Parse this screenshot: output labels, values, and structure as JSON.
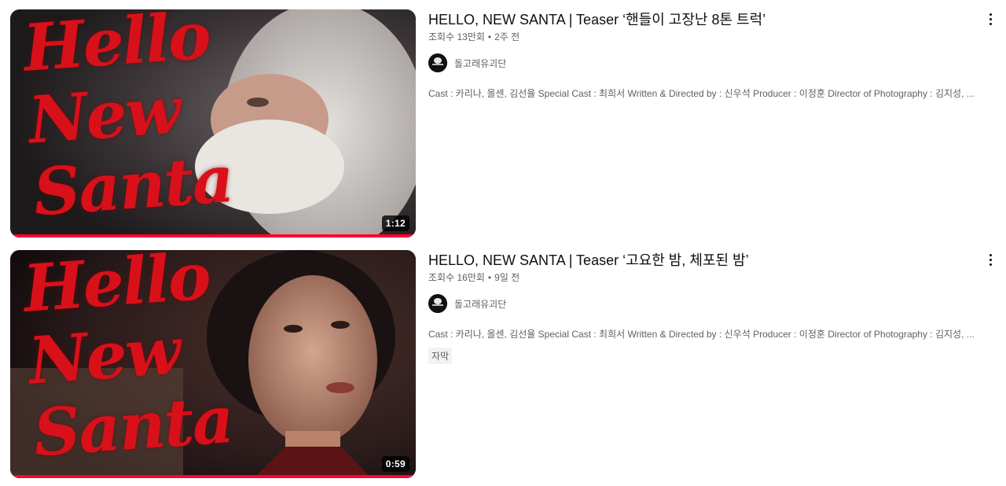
{
  "videos": [
    {
      "title": "HELLO, NEW SANTA | Teaser ‘핸들이 고장난 8톤 트럭’",
      "views": "조회수 13만회",
      "age": "2주 전",
      "channel": "돌고래유괴단",
      "description": "Cast : 카리나, 올센, 김선율 Special Cast : 최희서 Written & Directed by : 신우석 Producer : 이정훈 Director of Photography : 김지성, ...",
      "duration": "1:12",
      "thumbnail_text": "Hello\nNew\nSanta",
      "badge": "",
      "progress": 1.0
    },
    {
      "title": "HELLO, NEW SANTA | Teaser ‘고요한 밤, 체포된 밤’",
      "views": "조회수 16만회",
      "age": "9일 전",
      "channel": "돌고래유괴단",
      "description": "Cast : 카리나, 올센, 김선율 Special Cast : 최희서 Written & Directed by : 신우석 Producer : 이정훈 Director of Photography : 김지성, ...",
      "duration": "0:59",
      "thumbnail_text": "Hello\nNew\nSanta",
      "badge": "자막",
      "progress": 1.0
    }
  ],
  "colors": {
    "progress": "#ff0033",
    "title_script": "#d8101a"
  },
  "icons": {
    "more": "more-vert-icon"
  }
}
